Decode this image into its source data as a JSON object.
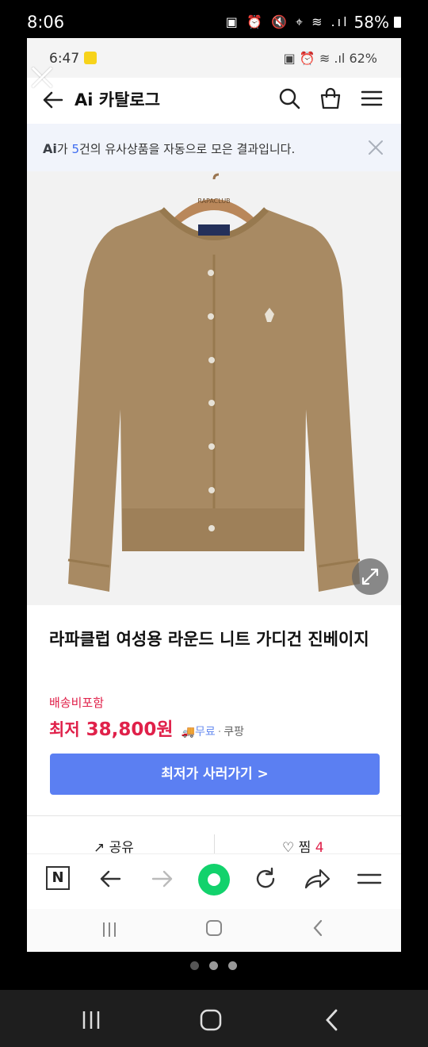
{
  "outer_status": {
    "time": "8:06",
    "icons": "▣ ⏰ 🔇 ⌖ ≋ .ıl",
    "battery": "58%"
  },
  "inner_status": {
    "time": "6:47",
    "icons": "▣ ⏰ ≋ .ıl",
    "battery": "62%"
  },
  "header": {
    "title": "Ai 카탈로그"
  },
  "banner": {
    "ai_logo": "Ai",
    "prefix": "가 ",
    "count": "5",
    "suffix": "건의 유사상품을 자동으로 모은 결과입니다."
  },
  "product": {
    "image_brand_label": "RAPACLUB",
    "title": "라파클럽 여성용 라운드 니트 가디건 진베이지",
    "shipping_note": "배송비포함",
    "price_label": "최저",
    "price": "38,800원",
    "shipping_icon": "🚚",
    "shipping": "무료",
    "dot": "·",
    "store": "쿠팡",
    "buy_button": "최저가 사러가기 >"
  },
  "actions": {
    "share": "공유",
    "like": "찜",
    "like_count": "4"
  },
  "browser": {
    "logo": "N"
  },
  "colors": {
    "accent_red": "#e0214a",
    "button_blue": "#5b7ff2",
    "naver_green": "#12d26c",
    "cardigan": "#a88a63"
  }
}
